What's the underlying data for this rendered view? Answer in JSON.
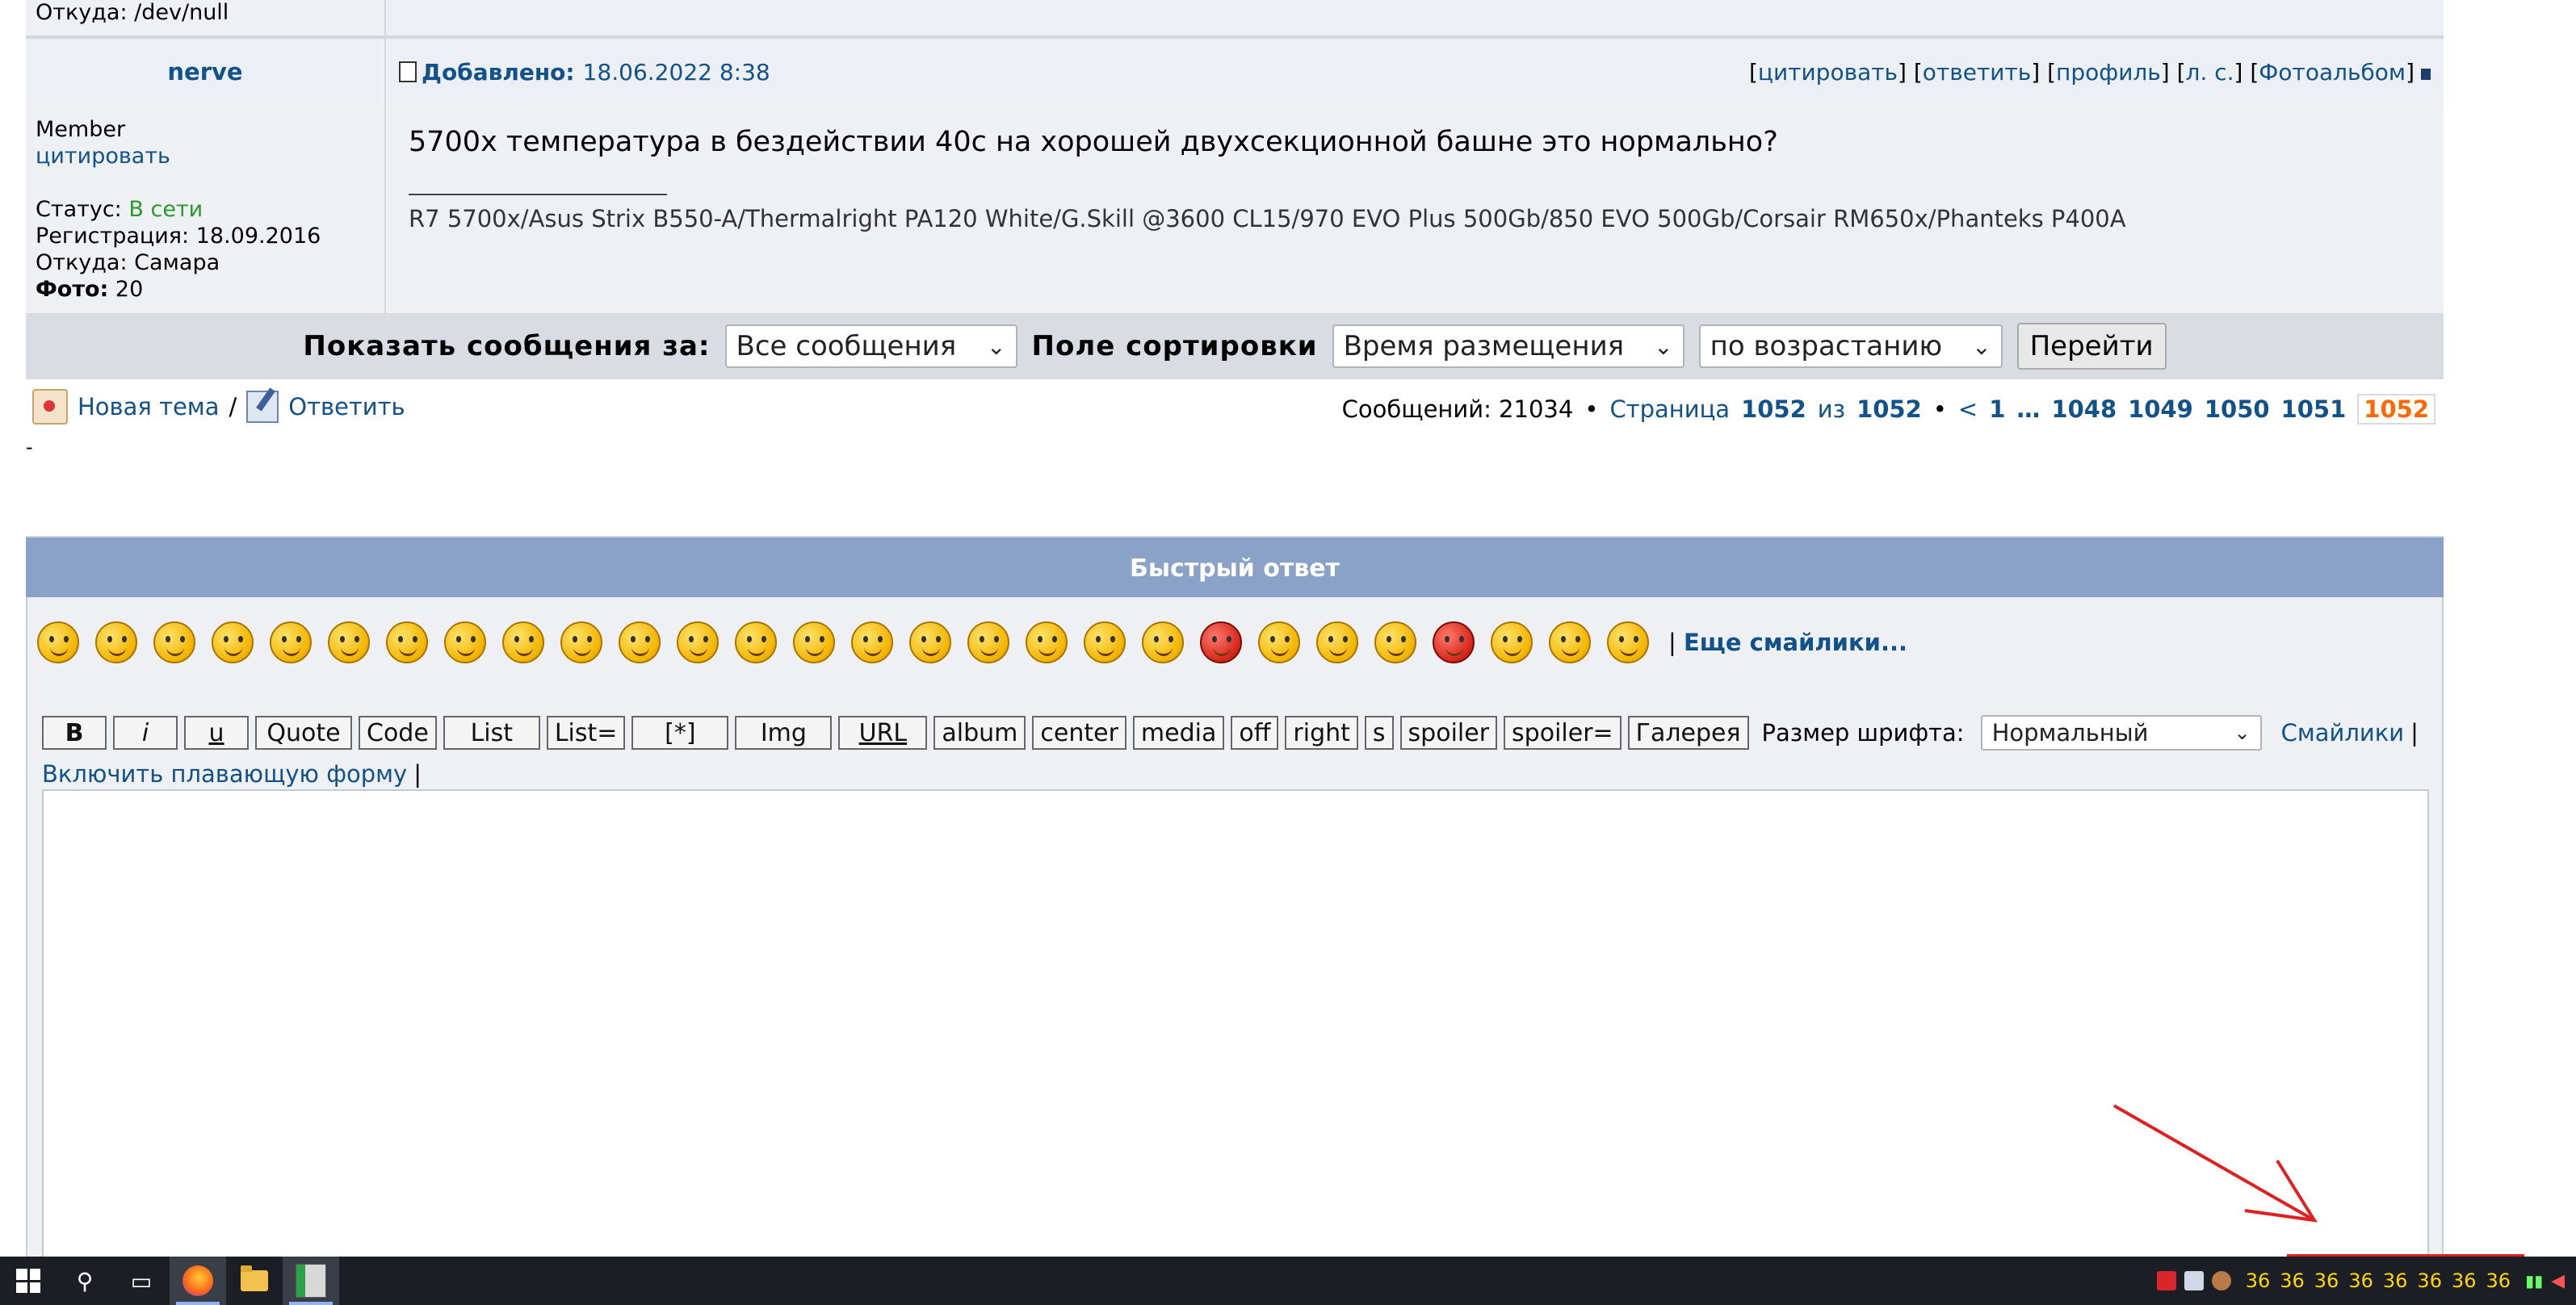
{
  "prev_post": {
    "from_line": "Откуда: /dev/null"
  },
  "post": {
    "author": "nerve",
    "added_label": "Добавлено:",
    "date": "18.06.2022 8:38",
    "actions": [
      "цитировать",
      "ответить",
      "профиль",
      "л. с.",
      "Фотоальбом"
    ],
    "rank": "Member",
    "quote_link": "цитировать",
    "status_label": "Статус:",
    "status_value": "В сети",
    "registration": "Регистрация: 18.09.2016",
    "location": "Откуда: Самара",
    "photo_label": "Фото:",
    "photo_count": "20",
    "message": "5700x температура в бездействии 40с на хорошей двухсекционной башне это нормально?",
    "signature": "R7 5700x/Asus Strix B550-A/Thermalright PA120 White/G.Skill @3600 CL15/970 EVO Plus 500Gb/850 EVO 500Gb/Corsair RM650x/Phanteks P400A"
  },
  "sortbar": {
    "show_label": "Показать сообщения за:",
    "show_value": "Все сообщения",
    "sort_label": "Поле сортировки",
    "sort_value": "Время размещения",
    "order_value": "по возрастанию",
    "go_label": "Перейти"
  },
  "actions_row": {
    "new_topic": "Новая тема",
    "separator": "/",
    "reply": "Ответить",
    "messages_text": "Сообщений: 21034",
    "bullet": "•",
    "page_label": "Страница",
    "current_page": "1052",
    "of_label": "из",
    "total_pages": "1052",
    "prev": "<",
    "pages": [
      "1",
      "1048",
      "1049",
      "1050",
      "1051"
    ],
    "ellipsis": "…",
    "active_page": "1052",
    "dash": "-"
  },
  "quick_reply": {
    "title": "Быстрый ответ",
    "more_smilies": "Еще смайлики...",
    "smiley_pipe": "|",
    "buttons": [
      "B",
      "i",
      "u",
      "Quote",
      "Code",
      "List",
      "List=",
      "[*]",
      "Img",
      "URL",
      "album",
      "center",
      "media",
      "off",
      "right",
      "s",
      "spoiler",
      "spoiler=",
      "Галерея"
    ],
    "font_size_label": "Размер шрифта:",
    "font_size_value": "Нормальный",
    "smilies_link": "Смайлики",
    "floating_form": "Включить плавающую форму",
    "pipe": "|"
  },
  "taskbar": {
    "temps": [
      "36",
      "36",
      "36",
      "36",
      "36",
      "36",
      "36",
      "36"
    ]
  },
  "colors": {
    "link": "#105289",
    "header_blue": "#8ba2c8",
    "annotation_red": "#e02020",
    "online": "#2a9a2a"
  }
}
